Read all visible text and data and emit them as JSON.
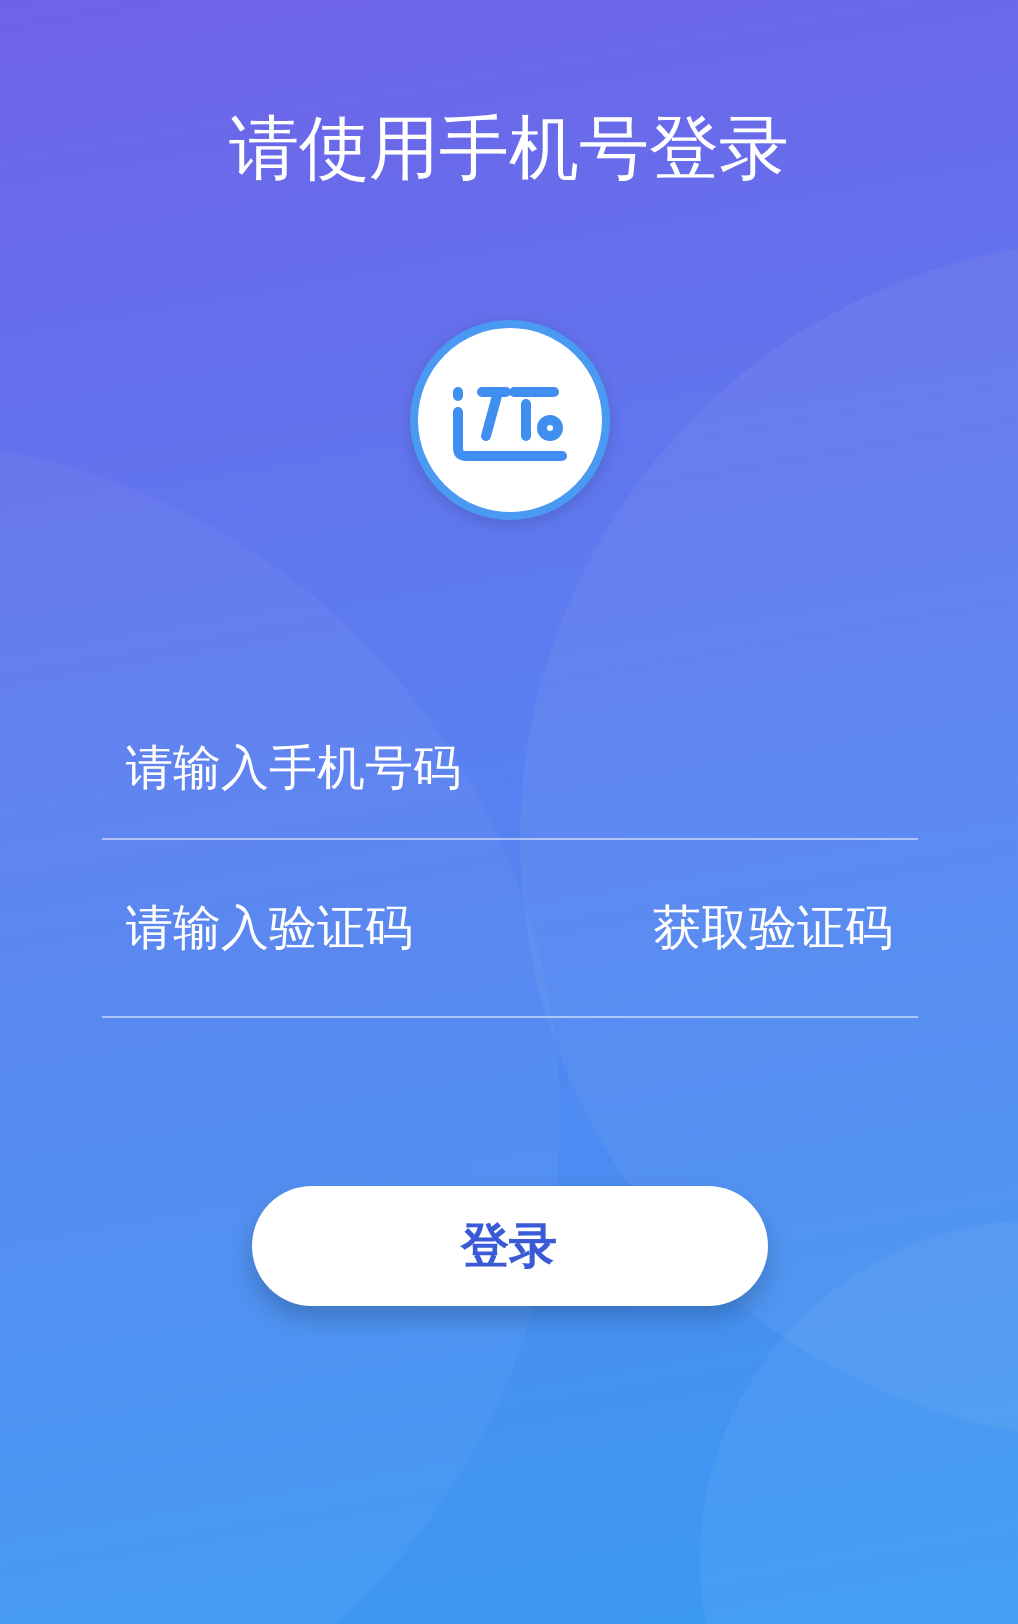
{
  "title": "请使用手机号登录",
  "phone_field": {
    "placeholder": "请输入手机号码"
  },
  "code_field": {
    "placeholder": "请输入验证码"
  },
  "get_code_link": "获取验证码",
  "login_button": "登录"
}
